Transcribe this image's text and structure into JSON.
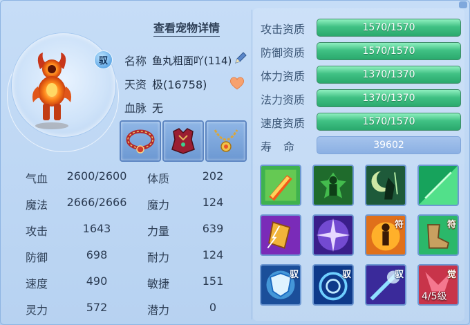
{
  "header": {
    "view_details": "查看宠物详情"
  },
  "pet": {
    "tame_badge": "驭",
    "name_label": "名称",
    "name_value": "鱼丸粗面吖(114)",
    "talent_label": "天资",
    "talent_value": "极(16758)",
    "bloodline_label": "血脉",
    "bloodline_value": "无"
  },
  "equipment": [
    {
      "icon": "red-jeweled-collar-icon"
    },
    {
      "icon": "crimson-armor-icon"
    },
    {
      "icon": "gold-pendant-necklace-icon"
    }
  ],
  "stats_left": [
    {
      "label": "气血",
      "value": "2600/2600"
    },
    {
      "label": "魔法",
      "value": "2666/2666"
    },
    {
      "label": "攻击",
      "value": "1643"
    },
    {
      "label": "防御",
      "value": "698"
    },
    {
      "label": "速度",
      "value": "490"
    },
    {
      "label": "灵力",
      "value": "572"
    }
  ],
  "stats_right": [
    {
      "label": "体质",
      "value": "202"
    },
    {
      "label": "魔力",
      "value": "124"
    },
    {
      "label": "力量",
      "value": "639"
    },
    {
      "label": "耐力",
      "value": "124"
    },
    {
      "label": "敏捷",
      "value": "151"
    },
    {
      "label": "潜力",
      "value": "0"
    }
  ],
  "aptitudes": [
    {
      "label": "攻击资质",
      "value": "1570/1570",
      "fill": 1.0
    },
    {
      "label": "防御资质",
      "value": "1570/1570",
      "fill": 1.0
    },
    {
      "label": "体力资质",
      "value": "1370/1370",
      "fill": 1.0
    },
    {
      "label": "法力资质",
      "value": "1370/1370",
      "fill": 1.0
    },
    {
      "label": "速度资质",
      "value": "1570/1570",
      "fill": 1.0
    }
  ],
  "lifespan": {
    "label": "寿命",
    "value": "39602"
  },
  "skills": [
    {
      "icon": "flaming-sword-skill-icon",
      "badge": ""
    },
    {
      "icon": "green-power-stance-skill-icon",
      "badge": ""
    },
    {
      "icon": "shadow-warrior-moon-skill-icon",
      "badge": ""
    },
    {
      "icon": "green-light-burst-skill-icon",
      "badge": ""
    },
    {
      "icon": "golden-scroll-lightning-skill-icon",
      "badge": ""
    },
    {
      "icon": "purple-radiance-skill-icon",
      "badge": ""
    },
    {
      "icon": "orange-figure-talisman-skill-icon",
      "badge": "符"
    },
    {
      "icon": "boot-talisman-skill-icon",
      "badge": "符"
    },
    {
      "icon": "cyan-shield-skill-icon",
      "badge": "驭"
    },
    {
      "icon": "blue-vortex-skill-icon",
      "badge": "驭"
    },
    {
      "icon": "blue-starburst-skill-icon",
      "badge": "驭"
    },
    {
      "icon": "red-awaken-skill-icon",
      "badge": "觉",
      "level": "4/5级"
    }
  ],
  "colors": {
    "panel_bg": "#b7d2f1",
    "bar_green": "#40c184",
    "bar_blue": "#8bb0e3",
    "label_text": "#3b5676"
  }
}
